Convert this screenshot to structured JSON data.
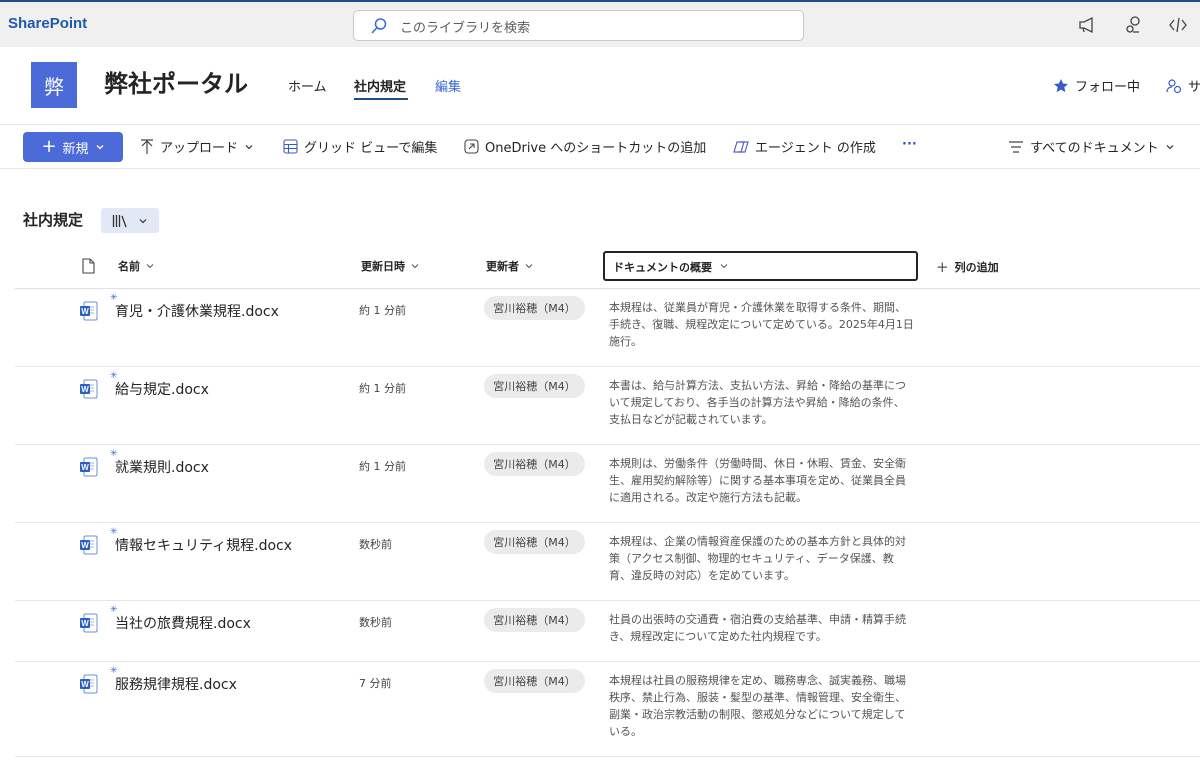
{
  "suite": {
    "brand": "SharePoint",
    "search_placeholder": "このライブラリを検索"
  },
  "site": {
    "logo_char": "弊",
    "title": "弊社ポータル",
    "nav": {
      "home": "ホーム",
      "current": "社内規定",
      "edit": "編集"
    },
    "follow": "フォロー中",
    "share_partial": "サ"
  },
  "command_bar": {
    "new": "新規",
    "upload": "アップロード",
    "grid_edit": "グリッド ビューで編集",
    "onedrive_shortcut": "OneDrive へのショートカットの追加",
    "agent_create": "エージェント の作成",
    "more": "···",
    "view_select": "すべてのドキュメント"
  },
  "library": {
    "title": "社内規定"
  },
  "columns": {
    "name": "名前",
    "modified": "更新日時",
    "modified_by": "更新者",
    "summary": "ドキュメントの概要",
    "add_column": "列の追加"
  },
  "rows": [
    {
      "name": "育児・介護休業規程.docx",
      "modified": "約 1 分前",
      "author": "宮川裕穂（M4）",
      "summary": "本規程は、従業員が育児・介護休業を取得する条件、期間、手続き、復職、規程改定について定めている。2025年4月1日施行。"
    },
    {
      "name": "給与規定.docx",
      "modified": "約 1 分前",
      "author": "宮川裕穂（M4）",
      "summary": "本書は、給与計算方法、支払い方法、昇給・降給の基準について規定しており、各手当の計算方法や昇給・降給の条件、支払日などが記載されています。"
    },
    {
      "name": "就業規則.docx",
      "modified": "約 1 分前",
      "author": "宮川裕穂（M4）",
      "summary": "本規則は、労働条件（労働時間、休日・休暇、賃金、安全衛生、雇用契約解除等）に関する基本事項を定め、従業員全員に適用される。改定や施行方法も記載。"
    },
    {
      "name": "情報セキュリティ規程.docx",
      "modified": "数秒前",
      "author": "宮川裕穂（M4）",
      "summary": "本規程は、企業の情報資産保護のための基本方針と具体的対策（アクセス制御、物理的セキュリティ、データ保護、教育、違反時の対応）を定めています。"
    },
    {
      "name": "当社の旅費規程.docx",
      "modified": "数秒前",
      "author": "宮川裕穂（M4）",
      "summary": "社員の出張時の交通費・宿泊費の支給基準、申請・精算手続き、規程改定について定めた社内規程です。"
    },
    {
      "name": "服務規律規程.docx",
      "modified": "7 分前",
      "author": "宮川裕穂（M4）",
      "summary": "本規程は社員の服務規律を定め、職務専念、誠実義務、職場秩序、禁止行為、服装・髪型の基準、情報管理、安全衛生、副業・政治宗教活動の制限、懲戒処分などについて規定している。"
    }
  ]
}
